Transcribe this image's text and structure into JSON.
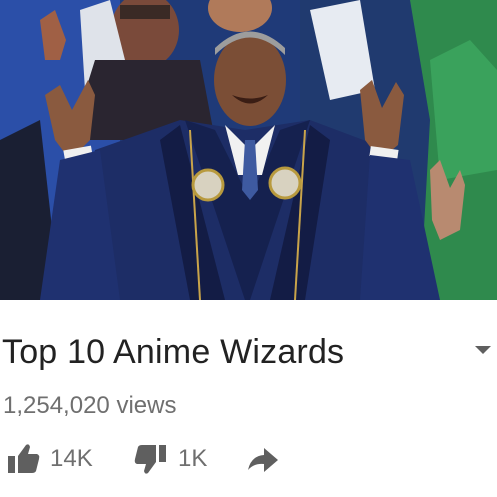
{
  "video": {
    "title": "Top 10 Anime Wizards",
    "views": "1,254,020 views"
  },
  "actions": {
    "like_count": "14K",
    "dislike_count": "1K"
  },
  "icons": {
    "like": "thumbs-up-icon",
    "dislike": "thumbs-down-icon",
    "share": "share-arrow-icon",
    "expand": "chevron-down-icon"
  },
  "colors": {
    "title": "#222222",
    "secondary_text": "#6f6f6f",
    "icon": "#5f5f5f",
    "background": "#ffffff"
  }
}
